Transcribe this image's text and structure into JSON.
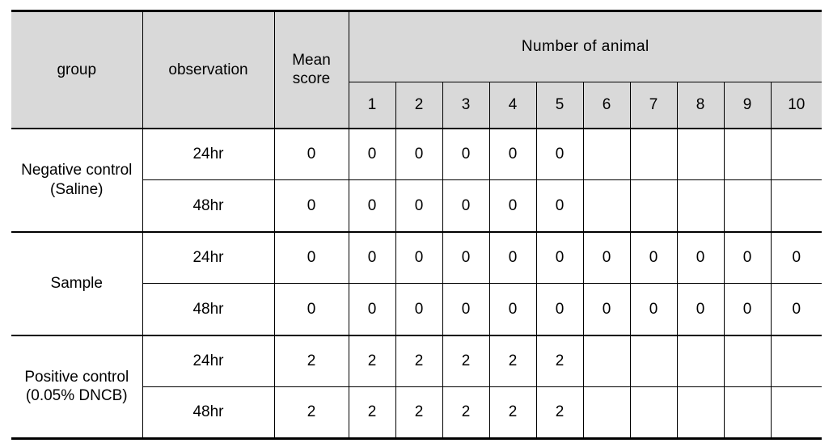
{
  "table": {
    "headers": {
      "group": "group",
      "observation": "observation",
      "mean_score": "Mean score",
      "number_of_animal": "Number  of  animal",
      "animal_columns": [
        "1",
        "2",
        "3",
        "4",
        "5",
        "6",
        "7",
        "8",
        "9",
        "10"
      ]
    },
    "groups": [
      {
        "name": "Negative control (Saline)",
        "rows": [
          {
            "observation": "24hr",
            "mean_score": "0",
            "values": [
              "0",
              "0",
              "0",
              "0",
              "0",
              "",
              "",
              "",
              "",
              ""
            ]
          },
          {
            "observation": "48hr",
            "mean_score": "0",
            "values": [
              "0",
              "0",
              "0",
              "0",
              "0",
              "",
              "",
              "",
              "",
              ""
            ]
          }
        ]
      },
      {
        "name": "Sample",
        "rows": [
          {
            "observation": "24hr",
            "mean_score": "0",
            "values": [
              "0",
              "0",
              "0",
              "0",
              "0",
              "0",
              "0",
              "0",
              "0",
              "0"
            ]
          },
          {
            "observation": "48hr",
            "mean_score": "0",
            "values": [
              "0",
              "0",
              "0",
              "0",
              "0",
              "0",
              "0",
              "0",
              "0",
              "0"
            ]
          }
        ]
      },
      {
        "name": "Positive control (0.05% DNCB)",
        "rows": [
          {
            "observation": "24hr",
            "mean_score": "2",
            "values": [
              "2",
              "2",
              "2",
              "2",
              "2",
              "",
              "",
              "",
              "",
              ""
            ]
          },
          {
            "observation": "48hr",
            "mean_score": "2",
            "values": [
              "2",
              "2",
              "2",
              "2",
              "2",
              "",
              "",
              "",
              "",
              ""
            ]
          }
        ]
      }
    ],
    "colors": {
      "header_background": "#d9d9d9",
      "border": "#000000",
      "text": "#000000",
      "cell_background": "#ffffff"
    }
  }
}
